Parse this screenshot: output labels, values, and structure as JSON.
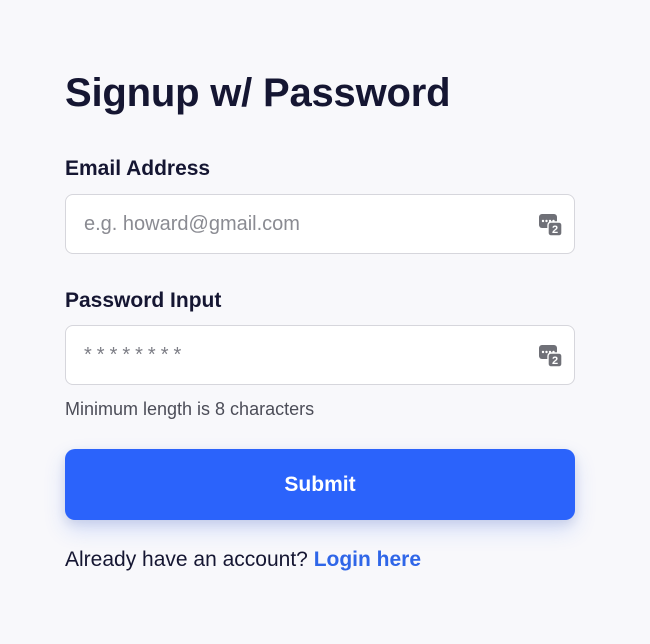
{
  "form": {
    "title": "Signup w/ Password",
    "email": {
      "label": "Email Address",
      "value": "",
      "placeholder": "e.g. howard@gmail.com",
      "icon": "password-manager-icon"
    },
    "password": {
      "label": "Password Input",
      "value": "",
      "placeholder": "********",
      "icon": "password-manager-icon",
      "hint": "Minimum length is 8 characters"
    },
    "submit_label": "Submit",
    "login": {
      "prompt": "Already have an account?",
      "link_label": "Login here"
    }
  },
  "colors": {
    "background": "#f8f8fb",
    "text": "#151632",
    "accent": "#2b63fb",
    "link": "#2f66e8"
  }
}
